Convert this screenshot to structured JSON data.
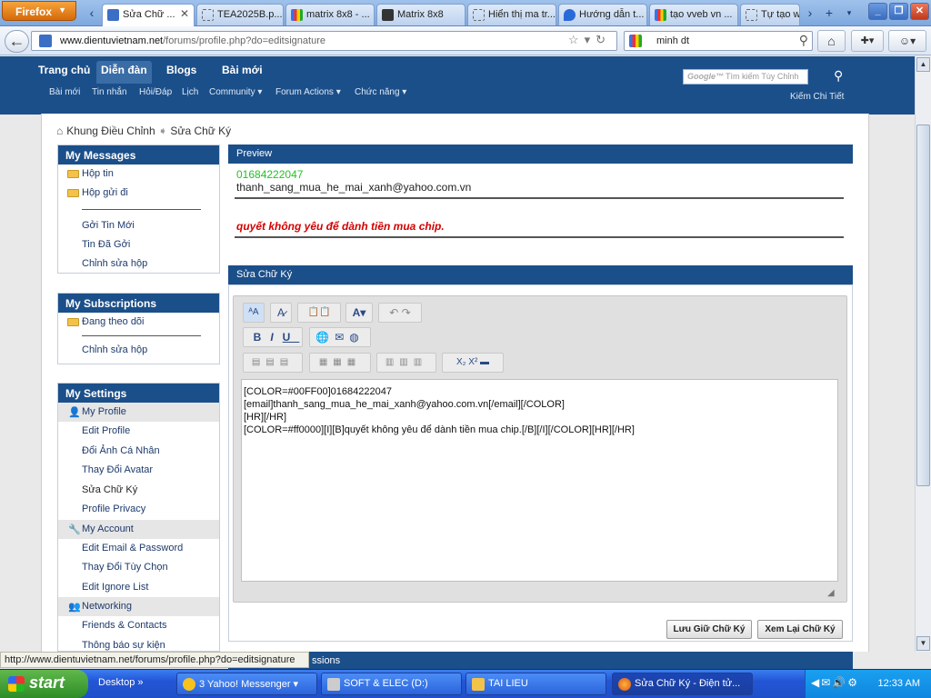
{
  "browser": {
    "app_button": "Firefox",
    "tabs": [
      {
        "label": "Sửa Chữ ...",
        "active": true
      },
      {
        "label": "TEA2025B.p..."
      },
      {
        "label": "matrix 8x8 - ..."
      },
      {
        "label": "Matrix 8x8"
      },
      {
        "label": "Hiển thị ma tr..."
      },
      {
        "label": "Hướng dẫn t..."
      },
      {
        "label": "tạo vveb vn ..."
      },
      {
        "label": "Tự tạo w"
      }
    ],
    "url_domain": "www.dientuvietnam.net",
    "url_path": "/forums/profile.php?do=editsignature",
    "search_query": "minh dt"
  },
  "site": {
    "main_nav": [
      "Trang chủ",
      "Diễn đàn",
      "Blogs",
      "Bài mới"
    ],
    "sub_nav": [
      "Bài mới",
      "Tin nhắn",
      "Hỏi/Đáp",
      "Lịch",
      "Community",
      "Forum Actions",
      "Chức năng"
    ],
    "search_logo": "Google™",
    "search_placeholder": "Tìm kiếm Tùy Chỉnh",
    "advanced_search": "Kiếm Chi Tiết"
  },
  "breadcrumb": {
    "root": "Khung Điều Chỉnh",
    "current": "Sửa Chữ Ký"
  },
  "sidebar": {
    "messages": {
      "title": "My Messages",
      "folders": [
        "Hộp tin",
        "Hộp gửi đi"
      ],
      "links": [
        "Gởi Tin Mới",
        "Tin Đã Gởi",
        "Chỉnh sửa hộp"
      ]
    },
    "subscriptions": {
      "title": "My Subscriptions",
      "folders": [
        "Đang theo dõi"
      ],
      "links": [
        "Chỉnh sửa hộp"
      ]
    },
    "settings": {
      "title": "My Settings",
      "profile_group": "My Profile",
      "profile_links": [
        "Edit Profile",
        "Đổi Ảnh Cá Nhân",
        "Thay Đổi Avatar",
        "Sửa Chữ Ký",
        "Profile Privacy"
      ],
      "account_group": "My Account",
      "account_links": [
        "Edit Email & Password",
        "Thay Đổi Tùy Chọn",
        "Edit Ignore List"
      ],
      "network_group": "Networking",
      "network_links": [
        "Friends & Contacts",
        "Thông báo sự kiện"
      ]
    }
  },
  "preview": {
    "title": "Preview",
    "phone": "01684222047",
    "email": "thanh_sang_mua_he_mai_xanh@yahoo.com.vn",
    "quote": "quyết không yêu để dành tiền mua chip."
  },
  "editor": {
    "title": "Sửa Chữ Ký",
    "content": "[COLOR=#00FF00]01684222047\n[email]thanh_sang_mua_he_mai_xanh@yahoo.com.vn[/email][/COLOR]\n[HR][/HR]\n[COLOR=#ff0000][I][B]quyết không yêu để dành tiền mua chip.[/B][/I][/COLOR][HR][/HR]",
    "save_button": "Lưu Giữ Chữ Ký",
    "preview_button": "Xem Lại Chữ Ký",
    "lower_panel_fragment": "ssions"
  },
  "statusbar": "http://www.dientuvietnam.net/forums/profile.php?do=editsignature",
  "taskbar": {
    "start": "start",
    "desktop": "Desktop",
    "tasks": [
      "3 Yahoo! Messenger",
      "SOFT & ELEC (D:)",
      "TAI LIEU",
      "Sửa Chữ Ký - Điện tử..."
    ],
    "time": "12:33 AM"
  },
  "colors": {
    "header_blue": "#1b4f8a",
    "preview_green": "#22c322",
    "preview_red": "#d40000"
  }
}
